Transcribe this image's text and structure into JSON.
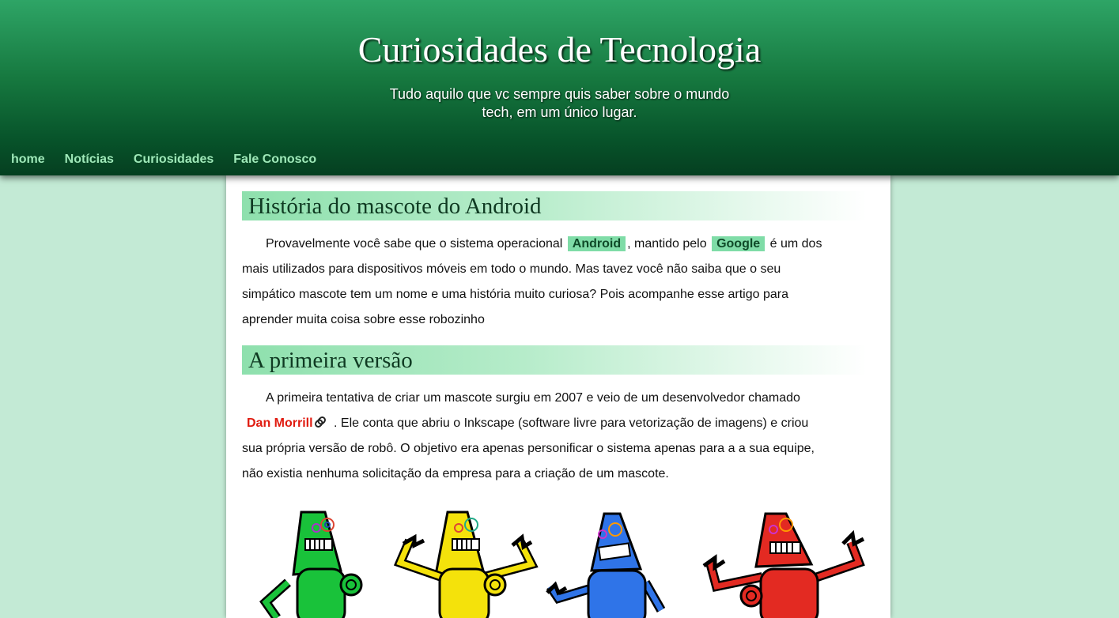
{
  "header": {
    "title": "Curiosidades de Tecnologia",
    "subtitle": "Tudo aquilo que vc sempre quis saber sobre o mundo tech, em um único lugar."
  },
  "nav": {
    "items": [
      "home",
      "Notícias",
      "Curiosidades",
      "Fale Conosco"
    ]
  },
  "article": {
    "heading1": "História do mascote do Android",
    "p1": {
      "text_a": "Provavelmente você sabe que o sistema operacional",
      "highlight_android": "Android",
      "text_b": ", mantido pelo",
      "highlight_google": "Google",
      "text_c": "é um dos mais utilizados para dispositivos móveis em todo o mundo. Mas tavez você não saiba que o seu simpático mascote tem um nome e uma história muito curiosa? Pois acompanhe esse artigo para aprender muita coisa sobre esse robozinho"
    },
    "heading2": "A primeira versão",
    "p2": {
      "text_a": "A primeira tentativa de criar um mascote surgiu em 2007 e veio de um desenvolvedor chamado",
      "link_name": "Dan Morrill",
      "link_icon": "paperclip-icon",
      "text_b": ". Ele conta que abriu o Inkscape (software livre para vetorização de imagens) e criou sua própria versão de robô. O objetivo era apenas personificar o sistema apenas para a a sua equipe, não existia nenhuma solicitação da empresa para a criação de um mascote."
    },
    "illustration": {
      "robot_colors": [
        "#19c23a",
        "#f4e20b",
        "#2f74e8",
        "#e32a22"
      ]
    }
  },
  "colors": {
    "page_background": "#c3ead5",
    "header_dark": "#053f20",
    "nav_text": "#9ee8b8",
    "highlight": "#7fdca7",
    "link_red": "#e01b10"
  }
}
